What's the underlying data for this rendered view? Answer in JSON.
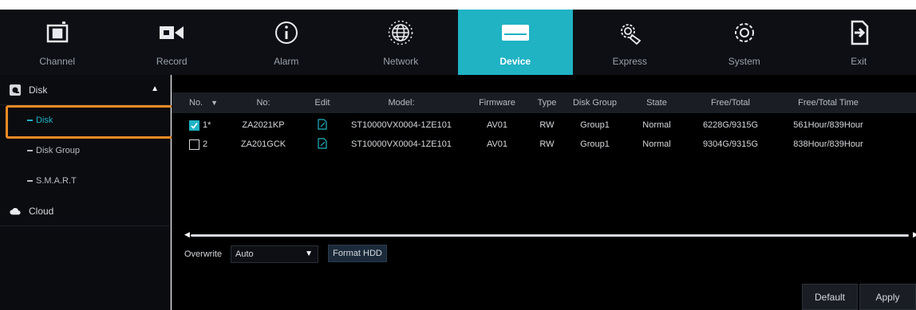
{
  "colors": {
    "accent": "#1fb3c4",
    "highlight": "#f08a24",
    "background": "#000000"
  },
  "topnav": [
    {
      "label": "Channel",
      "icon": "channel-icon"
    },
    {
      "label": "Record",
      "icon": "record-camera-icon"
    },
    {
      "label": "Alarm",
      "icon": "alarm-info-icon"
    },
    {
      "label": "Network",
      "icon": "network-globe-icon"
    },
    {
      "label": "Device",
      "icon": "device-hdd-icon",
      "active": true
    },
    {
      "label": "Express",
      "icon": "express-gear-hand-icon"
    },
    {
      "label": "System",
      "icon": "system-gear-icon"
    },
    {
      "label": "Exit",
      "icon": "exit-icon"
    }
  ],
  "sidebar": {
    "disk_section": "Disk",
    "items": [
      "Disk",
      "Disk Group",
      "S.M.A.R.T"
    ],
    "cloud_section": "Cloud"
  },
  "table": {
    "headers": {
      "no": "No.",
      "id": "No:",
      "edit": "Edit",
      "model": "Model:",
      "firmware": "Firmware",
      "type": "Type",
      "group": "Disk Group",
      "state": "State",
      "free": "Free/Total",
      "time": "Free/Total Time"
    },
    "rows": [
      {
        "no": "1*",
        "checked": true,
        "id": "ZA2021KP",
        "model": "ST10000VX0004-1ZE101",
        "firmware": "AV01",
        "type": "RW",
        "group": "Group1",
        "state": "Normal",
        "free": "6228G/9315G",
        "time": "561Hour/839Hour"
      },
      {
        "no": "2",
        "checked": false,
        "id": "ZA201GCK",
        "model": "ST10000VX0004-1ZE101",
        "firmware": "AV01",
        "type": "RW",
        "group": "Group1",
        "state": "Normal",
        "free": "9304G/9315G",
        "time": "838Hour/839Hour"
      }
    ]
  },
  "overwrite": {
    "label": "Overwrite",
    "value": "Auto"
  },
  "buttons": {
    "format": "Format HDD",
    "default": "Default",
    "apply": "Apply"
  }
}
